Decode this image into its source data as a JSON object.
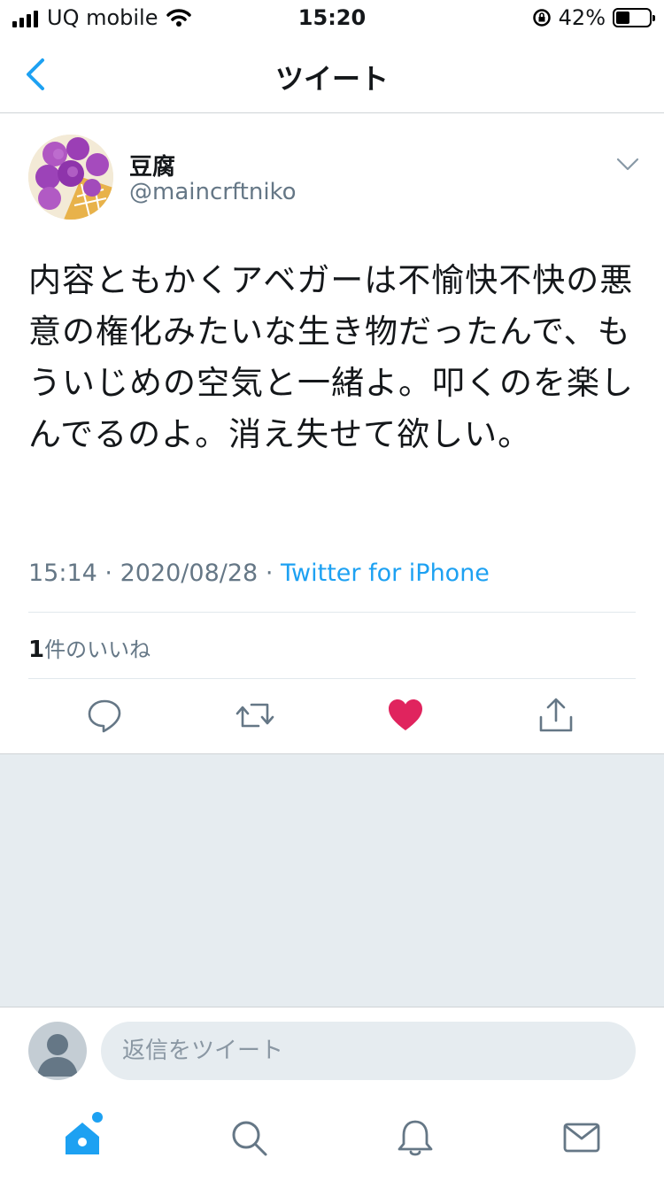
{
  "status_bar": {
    "carrier": "UQ mobile",
    "time": "15:20",
    "battery": "42%",
    "battery_level": 0.42
  },
  "nav": {
    "title": "ツイート",
    "back_icon": "chevron-left-icon"
  },
  "tweet": {
    "display_name": "豆腐",
    "handle": "@maincrftniko",
    "text": "内容ともかくアベガーは不愉快不快の悪意の権化みたいな生き物だったんで、もういじめの空気と一緒よ。叩くのを楽しんでるのよ。消え失せて欲しい。",
    "time": "15:14",
    "separator": "·",
    "date": "2020/08/28",
    "source": "Twitter for iPhone",
    "likes_count": "1",
    "likes_label": "件のいいね"
  },
  "actions": {
    "reply_icon": "reply-icon",
    "retweet_icon": "retweet-icon",
    "like_icon": "heart-icon",
    "share_icon": "share-icon",
    "like_color": "#e0245e"
  },
  "reply": {
    "placeholder": "返信をツイート"
  },
  "tabbar": {
    "items": [
      "home-icon",
      "search-icon",
      "notifications-icon",
      "messages-icon"
    ],
    "accent": "#1da1f2"
  }
}
